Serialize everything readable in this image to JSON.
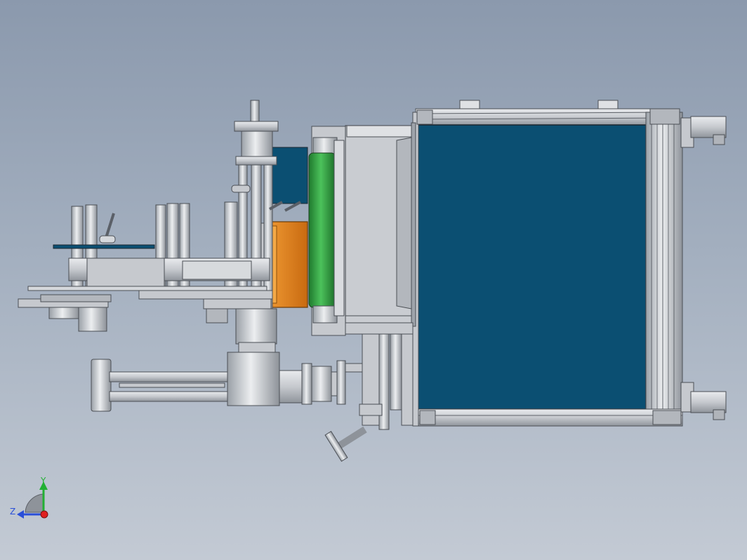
{
  "window": {
    "kind": "3D CAD model viewport"
  },
  "colors": {
    "background_top": "#8b99ad",
    "background_bottom": "#c3cad4",
    "metal": "#c9ccd1",
    "metal_dark": "#8e939a",
    "blue_panel": "#0b4f72",
    "green_roller": "#36a245",
    "orange_block": "#e0811c",
    "axis_x": "#e02020",
    "axis_y": "#22b033",
    "axis_z": "#2a4fd8"
  },
  "icons": {
    "triad": "coordinate-triad-icon"
  },
  "triad": {
    "y_label": "Y",
    "z_label": "Z"
  }
}
